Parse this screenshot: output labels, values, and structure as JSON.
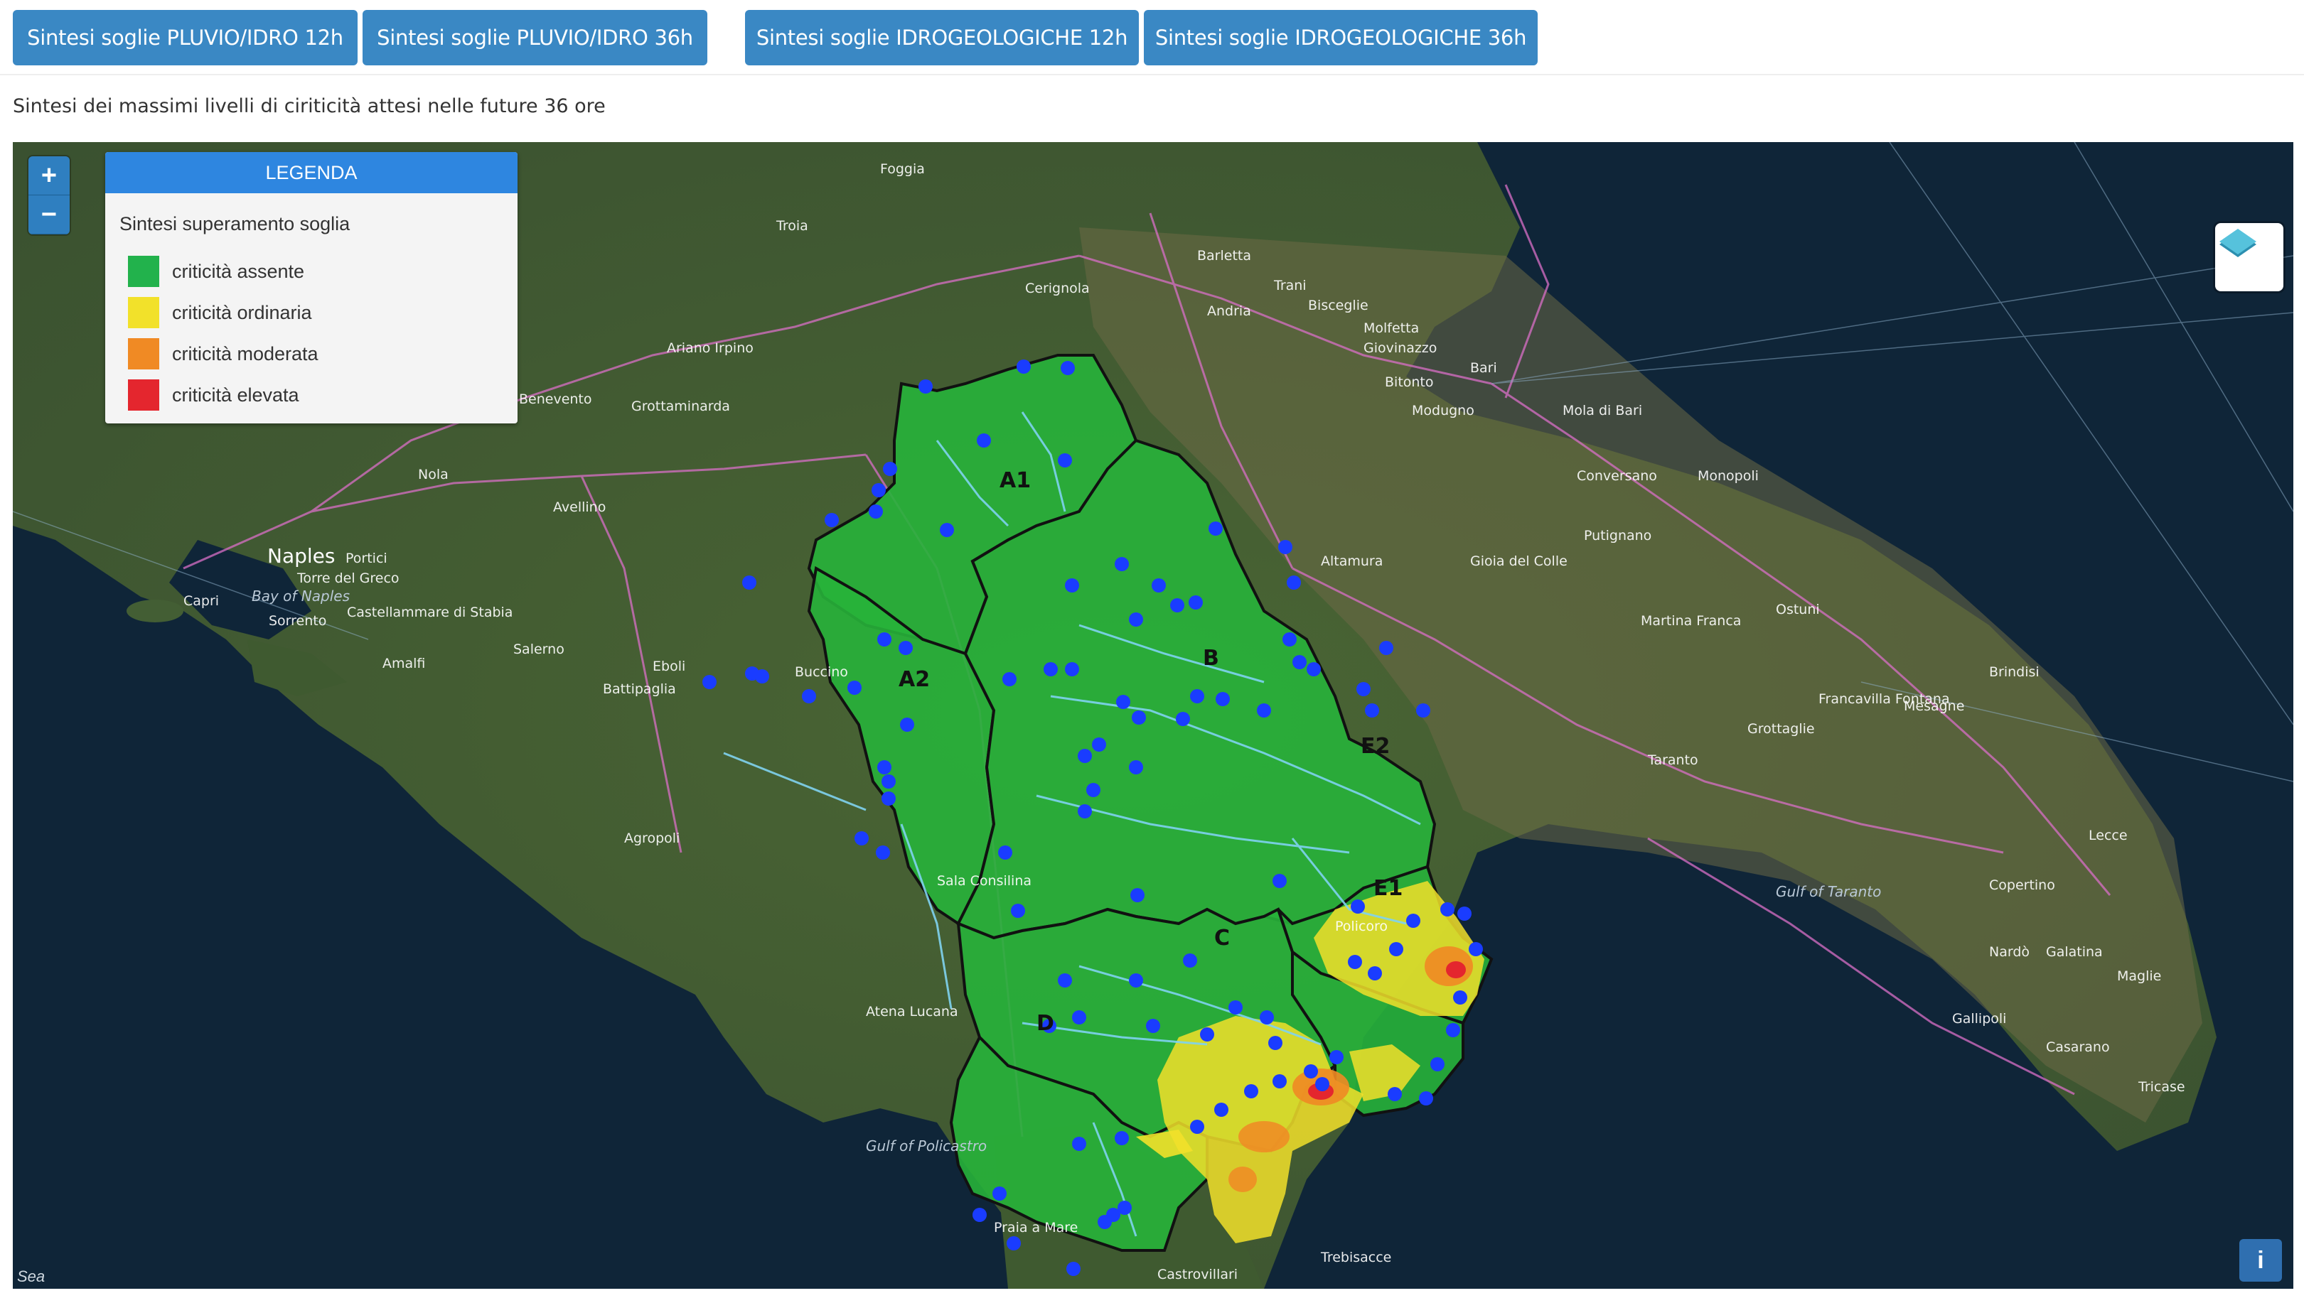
{
  "toolbar": {
    "buttons": [
      "Sintesi soglie PLUVIO/IDRO 12h",
      "Sintesi soglie PLUVIO/IDRO 36h",
      "Sintesi soglie IDROGEOLOGICHE 12h",
      "Sintesi soglie IDROGEOLOGICHE 36h"
    ]
  },
  "subtitle": "Sintesi dei massimi livelli di ciriticità attesi nelle future 36 ore",
  "map": {
    "zoom_in": "+",
    "zoom_out": "−",
    "legend": {
      "title": "LEGENDA",
      "subtitle": "Sintesi superamento soglia",
      "items": [
        {
          "label": "criticità assente",
          "color": "#22b24c"
        },
        {
          "label": "criticità ordinaria",
          "color": "#f2e12a"
        },
        {
          "label": "criticità moderata",
          "color": "#f08a24"
        },
        {
          "label": "criticità elevata",
          "color": "#e4262e"
        }
      ]
    },
    "zones": [
      "A1",
      "A2",
      "B",
      "C",
      "D",
      "E1",
      "E2"
    ],
    "places": [
      "Foggia",
      "Cerignola",
      "Barletta",
      "Trani",
      "Andria",
      "Bisceglie",
      "Molfetta",
      "Giovinazzo",
      "Bari",
      "Bitonto",
      "Modugno",
      "Mola di Bari",
      "Monopoli",
      "Conversano",
      "Putignano",
      "Gioia del Colle",
      "Altamura",
      "Martina Franca",
      "Ostuni",
      "Brindisi",
      "Taranto",
      "Grottaglie",
      "Francavilla Fontana",
      "Mesagne",
      "Lecce",
      "Copertino",
      "Nardò",
      "Galatina",
      "Maglie",
      "Gallipoli",
      "Casarano",
      "Tricase",
      "Naples",
      "Portici",
      "Torre del Greco",
      "Castellammare di Stabia",
      "Salerno",
      "Battipaglia",
      "Avellino",
      "Nola",
      "Ariano Irpino",
      "Grottaminarda",
      "Benevento",
      "Troia",
      "Eboli",
      "Buccino",
      "Agropoli",
      "Sala Consilina",
      "Praia a Mare",
      "Castrovillari",
      "Trebisacce",
      "Policoro",
      "Capri",
      "Sorrento",
      "Amalfi",
      "Atena Lucana"
    ],
    "seas": [
      "Bay of Naples",
      "Gulf of Policastro",
      "Gulf of Taranto",
      "Sea"
    ],
    "info_button": "i",
    "attribution": "Sea",
    "colors": {
      "sea": "#0e2436",
      "land": "#3d5a2e",
      "zone_fill": "#27b23a",
      "zone_border": "#111111",
      "station": "#1a3cff",
      "river": "#7fd3f0",
      "road": "#d96fc7"
    }
  }
}
